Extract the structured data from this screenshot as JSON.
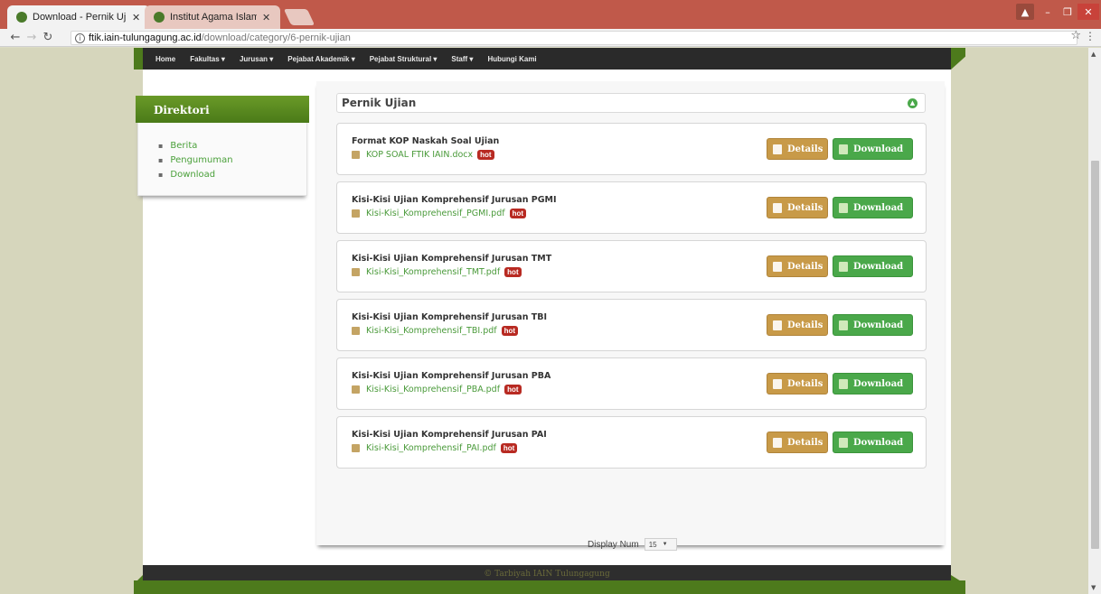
{
  "browser": {
    "tabs": [
      {
        "label": "Download - Pernik Ujian",
        "active": true
      },
      {
        "label": "Institut Agama Islam Neg",
        "active": false
      }
    ],
    "url_host": "ftik.iain-tulungagung.ac.id",
    "url_path": "/download/category/6-pernik-ujian"
  },
  "nav": {
    "items": [
      "Home",
      "Fakultas ▾",
      "Jurusan ▾",
      "Pejabat Akademik ▾",
      "Pejabat Struktural ▾",
      "Staff ▾",
      "Hubungi Kami"
    ]
  },
  "sidebar": {
    "title": "Direktori",
    "items": [
      "Berita",
      "Pengumuman",
      "Download"
    ]
  },
  "category": {
    "title": "Pernik Ujian"
  },
  "files": [
    {
      "title": "Format KOP Naskah Soal Ujian",
      "filename": "KOP SOAL FTIK IAIN.docx",
      "badge": "hot"
    },
    {
      "title": "Kisi-Kisi Ujian Komprehensif Jurusan PGMI",
      "filename": "Kisi-Kisi_Komprehensif_PGMI.pdf",
      "badge": "hot"
    },
    {
      "title": "Kisi-Kisi Ujian Komprehensif Jurusan TMT",
      "filename": "Kisi-Kisi_Komprehensif_TMT.pdf",
      "badge": "hot"
    },
    {
      "title": "Kisi-Kisi Ujian Komprehensif Jurusan TBI",
      "filename": "Kisi-Kisi_Komprehensif_TBI.pdf",
      "badge": "hot"
    },
    {
      "title": "Kisi-Kisi Ujian Komprehensif Jurusan PBA",
      "filename": "Kisi-Kisi_Komprehensif_PBA.pdf",
      "badge": "hot"
    },
    {
      "title": "Kisi-Kisi Ujian Komprehensif Jurusan PAI",
      "filename": "Kisi-Kisi_Komprehensif_PAI.pdf",
      "badge": "hot"
    }
  ],
  "buttons": {
    "details": "Details",
    "download": "Download"
  },
  "pagination": {
    "label": "Display Num",
    "value": "15"
  },
  "footer": {
    "text": "© Tarbiyah IAIN Tulungagung"
  },
  "colors": {
    "accent_green": "#4aa84a",
    "details_gold": "#c89a48",
    "header_green": "#4d7a1c",
    "hot_red": "#b82a22"
  }
}
